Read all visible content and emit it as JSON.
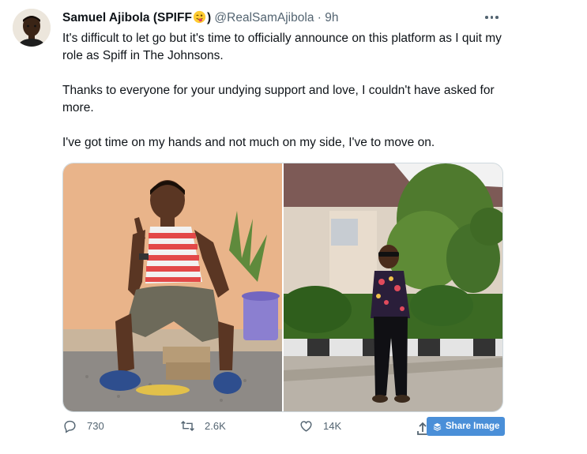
{
  "tweet": {
    "author_name": "Samuel Ajibola (SPIFF",
    "author_name_suffix": ")",
    "handle": "@RealSamAjibola",
    "time": "· 9h",
    "paragraphs": [
      "It's difficult to let go but it's time to officially announce on this platform as I quit my role as Spiff in The Johnsons.",
      "Thanks to everyone for your undying support and love, I couldn't have asked for more.",
      "I've got time on my hands and not much on my side, I've to move on."
    ]
  },
  "actions": {
    "replies": "730",
    "retweets": "2.6K",
    "likes": "14K"
  },
  "share_image": {
    "label": "Share Image"
  },
  "colors": {
    "text": "#0f1419",
    "secondary": "#536471",
    "share_button": "#4a8fd8"
  },
  "icons": [
    "more-icon",
    "reply-icon",
    "retweet-icon",
    "like-icon",
    "share-icon",
    "layers-icon"
  ]
}
